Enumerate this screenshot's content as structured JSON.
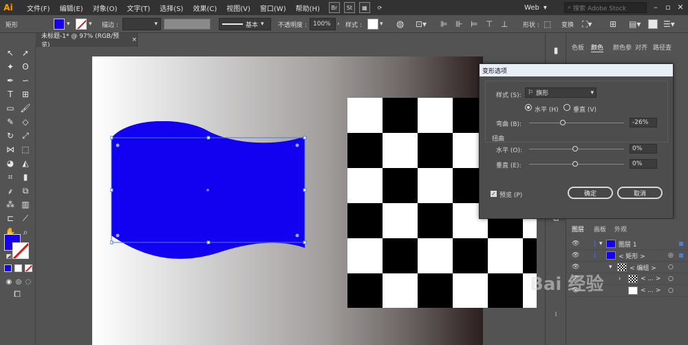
{
  "app": {
    "logo": "Ai"
  },
  "menu": [
    "文件(F)",
    "编辑(E)",
    "对象(O)",
    "文字(T)",
    "选择(S)",
    "效果(C)",
    "视图(V)",
    "窗口(W)",
    "帮助(H)"
  ],
  "menubar_buttons": {
    "bridge": "Br",
    "stock": "St"
  },
  "workspace": {
    "label": "Web"
  },
  "search": {
    "placeholder": "搜索 Adobe Stock"
  },
  "control_bar": {
    "object_type": "矩形",
    "stroke_label": "描边 :",
    "stroke_style": "基本",
    "opacity_label": "不透明度 :",
    "opacity_value": "100%",
    "style_label": "样式 :",
    "shape_label": "形状 :",
    "transform_label": "变换"
  },
  "document_tab": {
    "title": "未标题-1* @ 97% (RGB/预览)",
    "close": "×"
  },
  "colors": {
    "fill": "#1500ef",
    "artwork": "#1200f0",
    "selection": "#4f7bd9"
  },
  "dialog": {
    "title": "变形选项",
    "style_label": "样式 (S):",
    "style_value": "旗形",
    "horizontal_option": "水平 (H)",
    "vertical_option": "垂直 (V)",
    "bend_label": "弯曲 (B):",
    "bend_value": "-26%",
    "bend_level": -26,
    "distortion_label": "扭曲",
    "dist_h_label": "水平 (O):",
    "dist_h_value": "0%",
    "dist_v_label": "垂直 (E):",
    "dist_v_value": "0%",
    "preview_label": "预览 (P)",
    "ok_label": "确定",
    "cancel_label": "取消"
  },
  "panel_tabs_top": [
    "色板",
    "颜色",
    "颜色参",
    "对齐",
    "路径查"
  ],
  "layers_panel": {
    "tabs": [
      "图层",
      "画板",
      "外观"
    ],
    "rows": [
      {
        "name": "图层 1",
        "type": "layer"
      },
      {
        "name": "< 矩形 >",
        "type": "item"
      },
      {
        "name": "< 编组 >",
        "type": "group"
      },
      {
        "name": "< ... >",
        "type": "item"
      },
      {
        "name": "< ... >",
        "type": "item"
      }
    ]
  },
  "watermark": "Bai 经验"
}
